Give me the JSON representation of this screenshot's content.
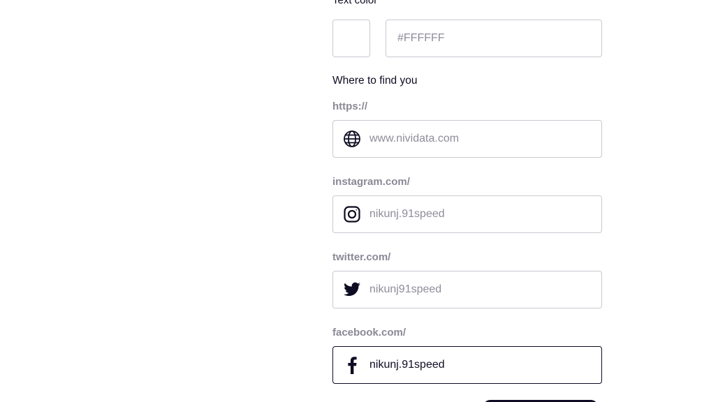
{
  "text_color": {
    "label": "Text color",
    "hex_placeholder": "#FFFFFF",
    "swatch_color": "#FFFFFF"
  },
  "where_to_find": {
    "heading": "Where to find you",
    "fields": [
      {
        "prefix": "https://",
        "icon": "globe-icon",
        "value": "",
        "placeholder": "www.nividata.com"
      },
      {
        "prefix": "instagram.com/",
        "icon": "instagram-icon",
        "value": "",
        "placeholder": "nikunj.91speed"
      },
      {
        "prefix": "twitter.com/",
        "icon": "twitter-icon",
        "value": "",
        "placeholder": "nikunj91speed"
      },
      {
        "prefix": "facebook.com/",
        "icon": "facebook-icon",
        "value": "nikunj.91speed",
        "placeholder": ""
      }
    ]
  },
  "colors": {
    "text": "#0D0C22",
    "border": "#C9C9D1",
    "muted": "#8A8996",
    "active_border": "#0D0C22"
  }
}
